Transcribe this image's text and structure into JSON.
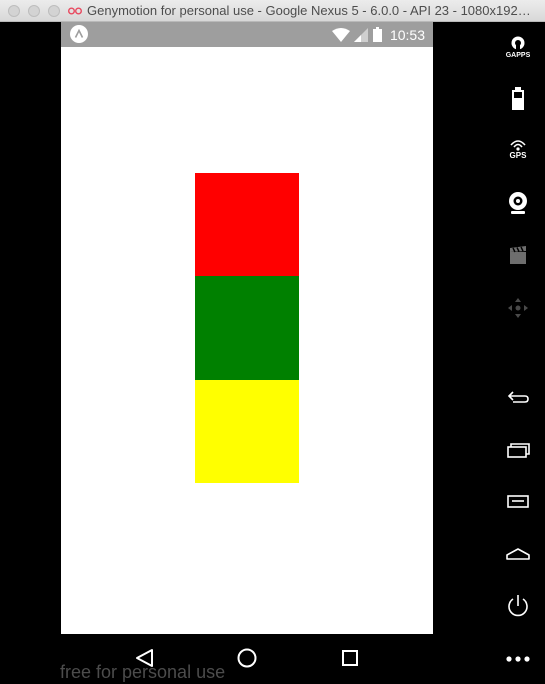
{
  "window": {
    "title": "Genymotion for personal use - Google Nexus 5 - 6.0.0 - API 23 - 1080x192…"
  },
  "status_bar": {
    "time": "10:53"
  },
  "screen": {
    "boxes": [
      {
        "color": "#ff0000"
      },
      {
        "color": "#008000"
      },
      {
        "color": "#ffff00"
      }
    ]
  },
  "watermark": "free for personal use",
  "toolbar": {
    "gapps_label": "GAPPS",
    "gps_label": "GPS"
  },
  "icons": [
    "gapps-icon",
    "battery-icon",
    "gps-icon",
    "webcam-icon",
    "clapper-icon",
    "dpad-icon",
    "back-icon",
    "recents-icon",
    "menu-icon",
    "home-icon",
    "power-icon",
    "more-icon"
  ]
}
